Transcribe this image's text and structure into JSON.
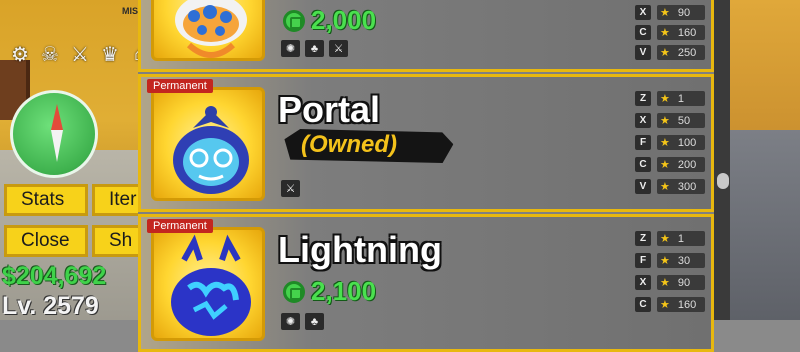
{
  "hud": {
    "top_text": "MIS",
    "icons": [
      "gear-icon",
      "skull-crossbones-icon",
      "swords-icon",
      "crew-icon",
      "house-icon"
    ],
    "menu": {
      "stats": "Stats",
      "items": "Iter",
      "close": "Close",
      "shop": "Sh"
    },
    "money": "$204,692",
    "level": "Lv. 2579"
  },
  "shop": {
    "items": [
      {
        "name": "",
        "badge": "",
        "price": "2,000",
        "ability_icons": [
          "melee-icon",
          "fruit-icon",
          "sword-icon"
        ],
        "moves": [
          {
            "key": "X",
            "level": "90"
          },
          {
            "key": "C",
            "level": "160"
          },
          {
            "key": "V",
            "level": "250"
          }
        ]
      },
      {
        "name": "Portal",
        "badge": "Permanent",
        "status": "(Owned)",
        "ability_icons": [
          "sword-icon"
        ],
        "moves": [
          {
            "key": "Z",
            "level": "1"
          },
          {
            "key": "X",
            "level": "50"
          },
          {
            "key": "F",
            "level": "100"
          },
          {
            "key": "C",
            "level": "200"
          },
          {
            "key": "V",
            "level": "300"
          }
        ]
      },
      {
        "name": "Lightning",
        "badge": "Permanent",
        "price": "2,100",
        "ability_icons": [
          "melee-icon",
          "fruit-icon"
        ],
        "moves": [
          {
            "key": "Z",
            "level": "1"
          },
          {
            "key": "F",
            "level": "30"
          },
          {
            "key": "X",
            "level": "90"
          },
          {
            "key": "C",
            "level": "160"
          }
        ]
      }
    ]
  },
  "colors": {
    "accent_yellow": "#f7d21a",
    "money_green": "#3fd24a",
    "badge_red": "#c3261f",
    "owned_gold": "#f4c21b"
  }
}
